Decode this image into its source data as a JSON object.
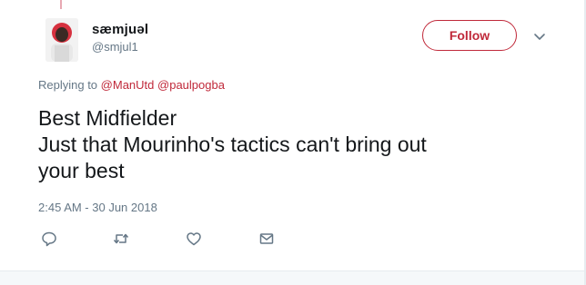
{
  "tweet": {
    "author": {
      "display_name": "sæmjuəl",
      "handle": "@smjul1"
    },
    "follow_label": "Follow",
    "replying": {
      "prefix": "Replying to",
      "mentions": [
        "@ManUtd",
        "@paulpogba"
      ]
    },
    "text_lines": [
      "Best Midfielder",
      "Just that Mourinho's tactics can't bring out",
      "your best"
    ],
    "timestamp": "2:45 AM - 30 Jun 2018",
    "actions": [
      {
        "name": "reply",
        "icon": "reply-icon"
      },
      {
        "name": "retweet",
        "icon": "retweet-icon"
      },
      {
        "name": "like",
        "icon": "heart-icon"
      },
      {
        "name": "message",
        "icon": "envelope-icon"
      }
    ]
  },
  "colors": {
    "accent": "#c0293a",
    "text": "#14171a",
    "muted": "#657786",
    "icon": "#657786",
    "divider": "#e6ecf0"
  }
}
